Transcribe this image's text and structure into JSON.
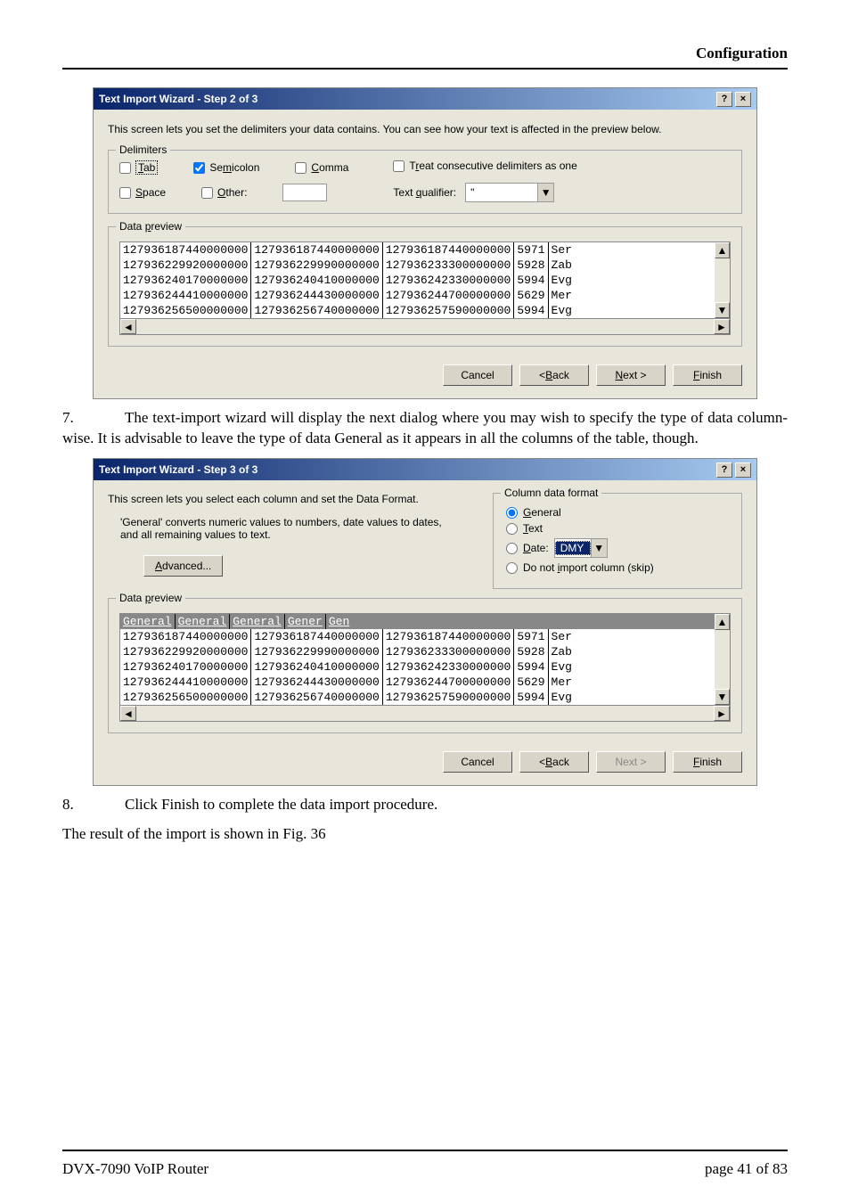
{
  "page_header": "Configuration",
  "wizard2": {
    "title": "Text Import Wizard - Step 2 of 3",
    "intro": "This screen lets you set the delimiters your data contains. You can see how your text is affected in the preview below.",
    "delimiters_legend": "Delimiters",
    "tab_label": "Tab",
    "semicolon_label": "Semicolon",
    "comma_label": "Comma",
    "space_label": "Space",
    "other_label": "Other:",
    "treat_consecutive_label": "Treat consecutive delimiters as one",
    "text_qualifier_label": "Text qualifier:",
    "text_qualifier_value": "\"",
    "preview_legend": "Data preview",
    "rows": [
      {
        "c1": "127936187440000000",
        "c2": "127936187440000000",
        "c3": "127936187440000000",
        "c4": "5971",
        "c5": "Ser"
      },
      {
        "c1": "127936229920000000",
        "c2": "127936229990000000",
        "c3": "127936233300000000",
        "c4": "5928",
        "c5": "Zab"
      },
      {
        "c1": "127936240170000000",
        "c2": "127936240410000000",
        "c3": "127936242330000000",
        "c4": "5994",
        "c5": "Evg"
      },
      {
        "c1": "127936244410000000",
        "c2": "127936244430000000",
        "c3": "127936244700000000",
        "c4": "5629",
        "c5": "Mer"
      },
      {
        "c1": "127936256500000000",
        "c2": "127936256740000000",
        "c3": "127936257590000000",
        "c4": "5994",
        "c5": "Evg"
      }
    ],
    "cancel": "Cancel",
    "back": "< Back",
    "next": "Next >",
    "finish": "Finish"
  },
  "para7": "The text-import wizard will display the next dialog where you may wish to specify the type of data column-wise. It is advisable to leave the type of data General as it appears in all the columns of the table, though.",
  "para7_num": "7.",
  "wizard3": {
    "title": "Text Import Wizard - Step 3 of 3",
    "intro1": "This screen lets you select each column and set the Data Format.",
    "intro2": "'General' converts numeric values to numbers, date values to dates, and all remaining values to text.",
    "advanced": "Advanced...",
    "cdf_legend": "Column data format",
    "general": "General",
    "text": "Text",
    "date": "Date:",
    "date_value": "DMY",
    "skip": "Do not import column (skip)",
    "preview_legend": "Data preview",
    "headers": {
      "h1": "General",
      "h2": "General",
      "h3": "General",
      "h4": "Gener",
      "h5": "Gen"
    },
    "rows": [
      {
        "c1": "127936187440000000",
        "c2": "127936187440000000",
        "c3": "127936187440000000",
        "c4": "5971",
        "c5": "Ser"
      },
      {
        "c1": "127936229920000000",
        "c2": "127936229990000000",
        "c3": "127936233300000000",
        "c4": "5928",
        "c5": "Zab"
      },
      {
        "c1": "127936240170000000",
        "c2": "127936240410000000",
        "c3": "127936242330000000",
        "c4": "5994",
        "c5": "Evg"
      },
      {
        "c1": "127936244410000000",
        "c2": "127936244430000000",
        "c3": "127936244700000000",
        "c4": "5629",
        "c5": "Mer"
      },
      {
        "c1": "127936256500000000",
        "c2": "127936256740000000",
        "c3": "127936257590000000",
        "c4": "5994",
        "c5": "Evg"
      }
    ],
    "cancel": "Cancel",
    "back": "< Back",
    "next": "Next >",
    "finish": "Finish"
  },
  "para8_num": "8.",
  "para8": "Click Finish to complete the data import procedure.",
  "para9": "The result of the import is shown in Fig. 36",
  "footer_left": "DVX-7090 VoIP Router",
  "footer_right": "page 41 of 83"
}
